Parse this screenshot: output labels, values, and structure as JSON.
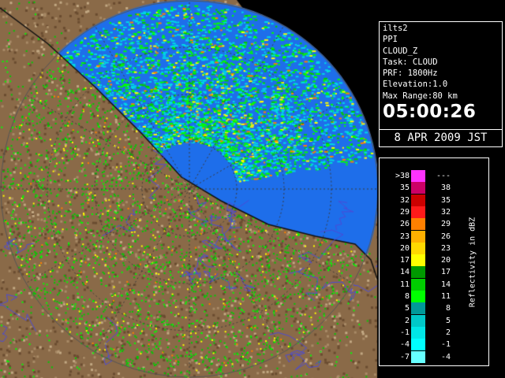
{
  "info": {
    "site": "ilts2",
    "mode": "PPI",
    "product": "CLOUD_Z",
    "task": "Task: CLOUD",
    "prf": "PRF: 1800Hz",
    "elevation": "Elevation:1.0",
    "max_range": "Max Range:80 km",
    "time": "05:00:26",
    "date": "8 APR 2009 JST"
  },
  "legend": {
    "title": "Reflectivity in dBZ",
    "rows": [
      {
        "lo": ">38",
        "hi": "---",
        "color": "#ff33ff"
      },
      {
        "lo": "35",
        "hi": "38",
        "color": "#cc0066"
      },
      {
        "lo": "32",
        "hi": "35",
        "color": "#cc0000"
      },
      {
        "lo": "29",
        "hi": "32",
        "color": "#ff1a1a"
      },
      {
        "lo": "26",
        "hi": "29",
        "color": "#ff8000"
      },
      {
        "lo": "23",
        "hi": "26",
        "color": "#ffb000"
      },
      {
        "lo": "20",
        "hi": "23",
        "color": "#ffd800"
      },
      {
        "lo": "17",
        "hi": "20",
        "color": "#ffff00"
      },
      {
        "lo": "14",
        "hi": "17",
        "color": "#009900"
      },
      {
        "lo": "11",
        "hi": "14",
        "color": "#00cc00"
      },
      {
        "lo": "8",
        "hi": "11",
        "color": "#00ff00"
      },
      {
        "lo": "5",
        "hi": "8",
        "color": "#009999"
      },
      {
        "lo": "2",
        "hi": "5",
        "color": "#00c8c8"
      },
      {
        "lo": "-1",
        "hi": "2",
        "color": "#00e6e6"
      },
      {
        "lo": "-4",
        "hi": "-1",
        "color": "#00ffff"
      },
      {
        "lo": "-7",
        "hi": "-4",
        "color": "#66ffff"
      }
    ]
  },
  "colors": {
    "sea": "#1e6eea",
    "land": "#8a6a48",
    "rings": "#3a3a3a"
  }
}
